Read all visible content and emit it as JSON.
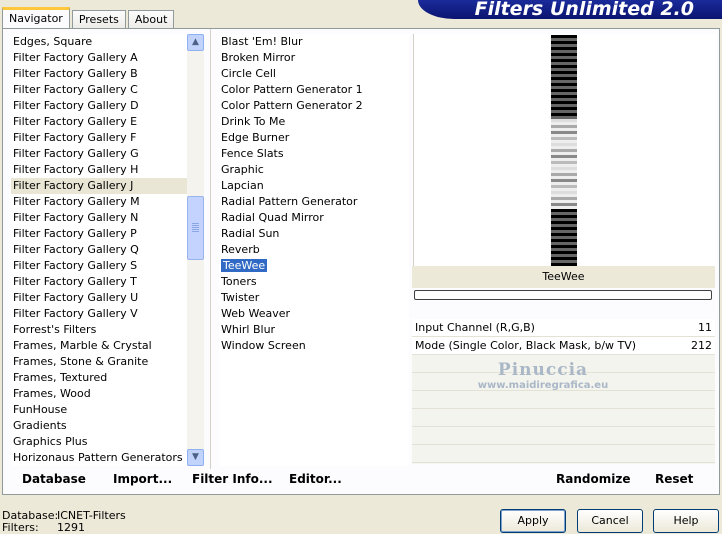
{
  "tabs": [
    "Navigator",
    "Presets",
    "About"
  ],
  "title": "Filters Unlimited 2.0",
  "categories": [
    "Edges, Square",
    "Filter Factory Gallery A",
    "Filter Factory Gallery B",
    "Filter Factory Gallery C",
    "Filter Factory Gallery D",
    "Filter Factory Gallery E",
    "Filter Factory Gallery F",
    "Filter Factory Gallery G",
    "Filter Factory Gallery H",
    "Filter Factory Gallery J",
    "Filter Factory Gallery M",
    "Filter Factory Gallery N",
    "Filter Factory Gallery P",
    "Filter Factory Gallery Q",
    "Filter Factory Gallery S",
    "Filter Factory Gallery T",
    "Filter Factory Gallery U",
    "Filter Factory Gallery V",
    "Forrest's Filters",
    "Frames, Marble & Crystal",
    "Frames, Stone & Granite",
    "Frames, Textured",
    "Frames, Wood",
    "FunHouse",
    "Gradients",
    "Graphics Plus",
    "Horizonaus Pattern Generators"
  ],
  "selected_category": "Filter Factory Gallery J",
  "filters": [
    "Blast 'Em! Blur",
    "Broken Mirror",
    "Circle Cell",
    "Color Pattern Generator 1",
    "Color Pattern Generator 2",
    "Drink To Me",
    "Edge Burner",
    "Fence Slats",
    "Graphic",
    "Lapcian",
    "Radial Pattern Generator",
    "Radial Quad Mirror",
    "Radial Sun",
    "Reverb",
    "TeeWee",
    "Toners",
    "Twister",
    "Web Weaver",
    "Whirl Blur",
    "Window Screen"
  ],
  "selected_filter": "TeeWee",
  "preview": {
    "label": "TeeWee"
  },
  "params": [
    {
      "label": "Input Channel (R,G,B)",
      "value": "11"
    },
    {
      "label": "Mode (Single Color, Black Mask, b/w TV)",
      "value": "212"
    }
  ],
  "watermark": {
    "name": "Pinuccia",
    "url": "www.maidiregrafica.eu"
  },
  "panel_buttons": {
    "database": "Database",
    "import": "Import...",
    "filter_info": "Filter Info...",
    "editor": "Editor...",
    "randomize": "Randomize",
    "reset": "Reset"
  },
  "footer": {
    "database_label": "Database:",
    "database_value": "ICNET-Filters",
    "filters_label": "Filters:",
    "filters_value": "1291"
  },
  "buttons": {
    "apply": "Apply",
    "cancel": "Cancel",
    "help": "Help"
  },
  "colors": {
    "title_bg": "#0a1470",
    "selection": "#316ac5",
    "window_bg": "#ece9d8"
  }
}
